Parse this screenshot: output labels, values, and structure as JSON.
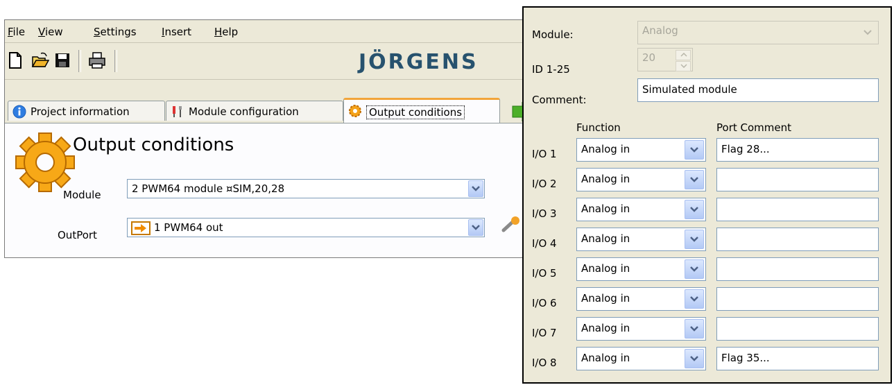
{
  "menu": [
    {
      "mnemonic": "F",
      "rest": "ile"
    },
    {
      "mnemonic": "V",
      "rest": "iew"
    },
    {
      "mnemonic": "S",
      "rest": "ettings"
    },
    {
      "mnemonic": "I",
      "rest": "nsert"
    },
    {
      "mnemonic": "H",
      "rest": "elp"
    }
  ],
  "toolbar": {
    "icons": [
      "new-file-icon",
      "open-folder-icon",
      "save-icon",
      "print-icon"
    ],
    "brand": "JÖRGENS"
  },
  "tabs": [
    {
      "label": "Project information",
      "icon": "info-icon",
      "active": false
    },
    {
      "label": "Module configuration",
      "icon": "config-icon",
      "active": false
    },
    {
      "label": "Output conditions",
      "icon": "gear-icon",
      "active": true
    }
  ],
  "output": {
    "title": "Output conditions",
    "module_label": "Module",
    "module_value": "2 PWM64 module  ¤SIM,20,28",
    "outport_label": "OutPort",
    "outport_value": "1  PWM64 out"
  },
  "dialog": {
    "module_label": "Module:",
    "module_value": "Analog",
    "id_label": "ID 1-25",
    "id_value": "20",
    "comment_label": "Comment:",
    "comment_value": "Simulated module",
    "function_header": "Function",
    "port_comment_header": "Port Comment",
    "rows": [
      {
        "io": "I/O 1",
        "function": "Analog in",
        "comment": "Flag 28..."
      },
      {
        "io": "I/O 2",
        "function": "Analog in",
        "comment": ""
      },
      {
        "io": "I/O 3",
        "function": "Analog in",
        "comment": ""
      },
      {
        "io": "I/O 4",
        "function": "Analog in",
        "comment": ""
      },
      {
        "io": "I/O 5",
        "function": "Analog in",
        "comment": ""
      },
      {
        "io": "I/O 6",
        "function": "Analog in",
        "comment": ""
      },
      {
        "io": "I/O 7",
        "function": "Analog in",
        "comment": ""
      },
      {
        "io": "I/O 8",
        "function": "Analog in",
        "comment": "Flag 35..."
      }
    ]
  },
  "colors": {
    "accent_tab": "#f2a53a",
    "brand": "#27526e",
    "field_border": "#7f9db9"
  }
}
